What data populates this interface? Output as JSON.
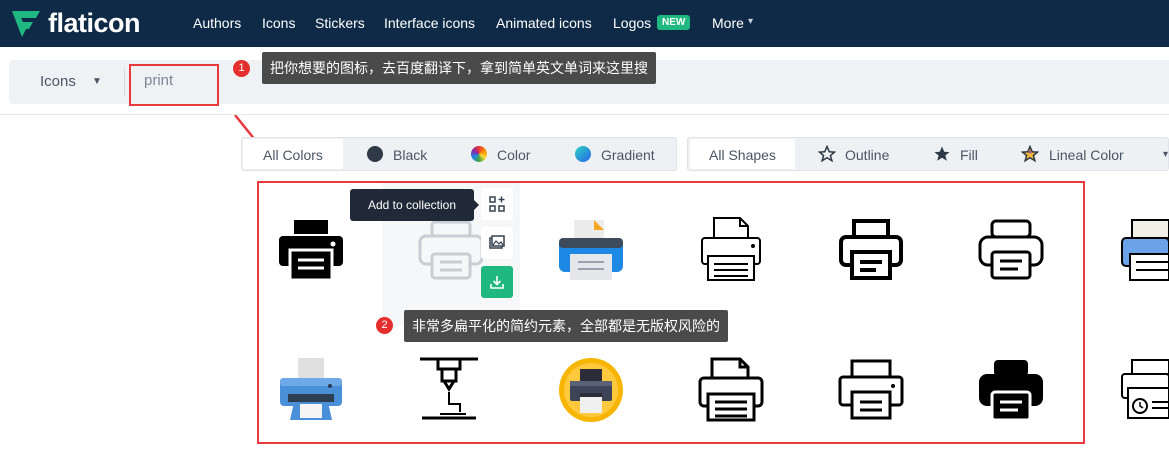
{
  "header": {
    "logo_text": "flaticon",
    "nav": [
      "Authors",
      "Icons",
      "Stickers",
      "Interface icons",
      "Animated icons",
      "Logos",
      "More"
    ],
    "new_badge": "NEW"
  },
  "search": {
    "type_label": "Icons",
    "query": "print"
  },
  "annotations": {
    "a1_num": "1",
    "a1_text": "把你想要的图标，去百度翻译下，拿到简单英文单词来这里搜",
    "a2_num": "2",
    "a2_text": "非常多扁平化的简约元素，全部都是无版权风险的"
  },
  "filters": {
    "colors": [
      "All Colors",
      "Black",
      "Color",
      "Gradient"
    ],
    "shapes": [
      "All Shapes",
      "Outline",
      "Fill",
      "Lineal Color"
    ]
  },
  "tooltip": "Add to collection",
  "icons": {
    "names": [
      "printer-fill-icon",
      "printer-gray-icon",
      "printer-color-icon",
      "printer-outline-icon",
      "printer-bold-outline-icon",
      "printer-rounded-outline-icon",
      "printer-blue-partial-icon",
      "printer-blue-flat-icon",
      "3d-printer-icon",
      "printer-circle-badge-icon",
      "printer-paper-outline-icon",
      "printer-thin-outline-icon",
      "printer-solid-icon",
      "printer-clock-partial-icon"
    ]
  },
  "colors": {
    "nav_bg": "#0e2a47",
    "accent_green": "#1fb881",
    "highlight_red": "#e8393f"
  }
}
